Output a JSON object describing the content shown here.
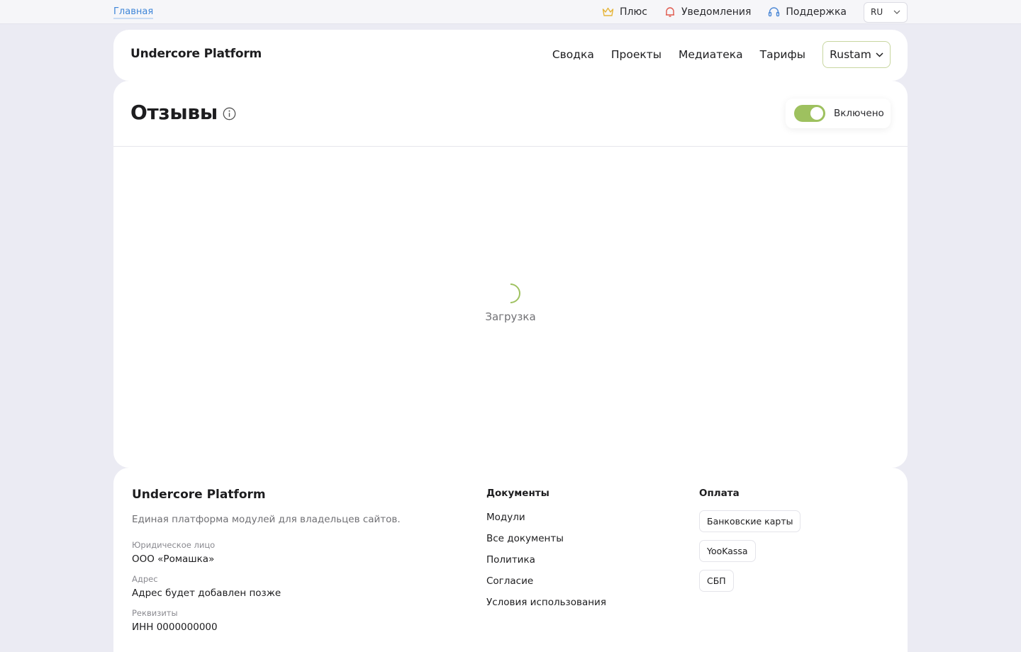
{
  "topbar": {
    "breadcrumb": "Главная",
    "links": [
      {
        "label": "Плюс",
        "icon": "crown-icon"
      },
      {
        "label": "Уведомления",
        "icon": "bell-icon"
      },
      {
        "label": "Поддержка",
        "icon": "headset-icon"
      }
    ],
    "language": "RU"
  },
  "header": {
    "logo": "Undercore Platform",
    "nav": [
      "Сводка",
      "Проекты",
      "Медиатека",
      "Тарифы"
    ],
    "user": "Rustam"
  },
  "main": {
    "title": "Отзывы",
    "toggle_label": "Включено",
    "toggle_on": true,
    "loading_text": "Загрузка"
  },
  "footer": {
    "logo": "Undercore Platform",
    "description": "Единая платформа модулей для владельцев сайтов.",
    "legal_label": "Юридическое лицо",
    "legal_value": "ООО «Ромашка»",
    "address_label": "Адрес",
    "address_value": "Адрес будет добавлен позже",
    "details_label": "Реквизиты",
    "details_value": "ИНН 0000000000",
    "docs_title": "Документы",
    "docs": [
      "Модули",
      "Все документы",
      "Политика",
      "Согласие",
      "Условия использования"
    ],
    "payment_title": "Оплата",
    "payments": [
      "Банковские карты",
      "YooKassa",
      "СБП"
    ]
  },
  "colors": {
    "accent_green": "#9ec15f",
    "link_blue": "#3f86d8",
    "background": "#ebebf3"
  }
}
